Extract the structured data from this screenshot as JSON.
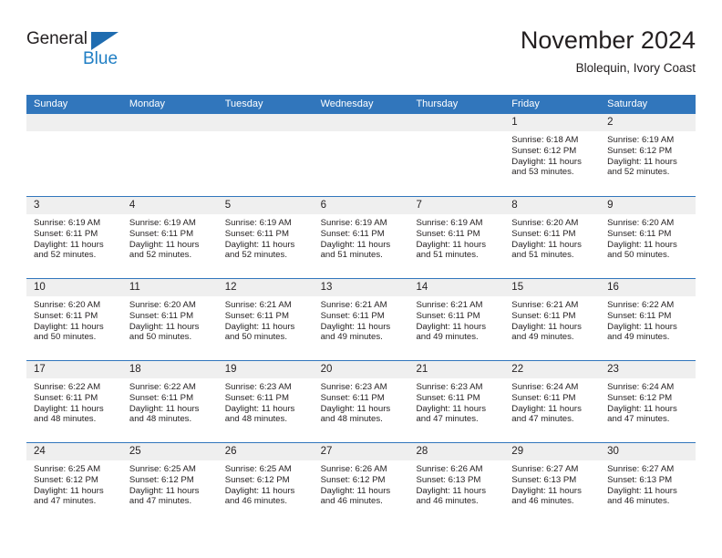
{
  "brand": {
    "name_top": "General",
    "name_bottom": "Blue",
    "triangle_color": "#1f6cb0",
    "blue_color": "#1f7ec4"
  },
  "header": {
    "title": "November 2024",
    "subtitle": "Blolequin, Ivory Coast"
  },
  "theme": {
    "header_blue": "#3176bc",
    "day_band_gray": "#efefef",
    "text": "#231f20"
  },
  "weekdays": [
    "Sunday",
    "Monday",
    "Tuesday",
    "Wednesday",
    "Thursday",
    "Friday",
    "Saturday"
  ],
  "weeks": [
    [
      {
        "day": "",
        "sunrise": "",
        "sunset": "",
        "daylight_line1": "",
        "daylight_line2": ""
      },
      {
        "day": "",
        "sunrise": "",
        "sunset": "",
        "daylight_line1": "",
        "daylight_line2": ""
      },
      {
        "day": "",
        "sunrise": "",
        "sunset": "",
        "daylight_line1": "",
        "daylight_line2": ""
      },
      {
        "day": "",
        "sunrise": "",
        "sunset": "",
        "daylight_line1": "",
        "daylight_line2": ""
      },
      {
        "day": "",
        "sunrise": "",
        "sunset": "",
        "daylight_line1": "",
        "daylight_line2": ""
      },
      {
        "day": "1",
        "sunrise": "Sunrise: 6:18 AM",
        "sunset": "Sunset: 6:12 PM",
        "daylight_line1": "Daylight: 11 hours",
        "daylight_line2": "and 53 minutes."
      },
      {
        "day": "2",
        "sunrise": "Sunrise: 6:19 AM",
        "sunset": "Sunset: 6:12 PM",
        "daylight_line1": "Daylight: 11 hours",
        "daylight_line2": "and 52 minutes."
      }
    ],
    [
      {
        "day": "3",
        "sunrise": "Sunrise: 6:19 AM",
        "sunset": "Sunset: 6:11 PM",
        "daylight_line1": "Daylight: 11 hours",
        "daylight_line2": "and 52 minutes."
      },
      {
        "day": "4",
        "sunrise": "Sunrise: 6:19 AM",
        "sunset": "Sunset: 6:11 PM",
        "daylight_line1": "Daylight: 11 hours",
        "daylight_line2": "and 52 minutes."
      },
      {
        "day": "5",
        "sunrise": "Sunrise: 6:19 AM",
        "sunset": "Sunset: 6:11 PM",
        "daylight_line1": "Daylight: 11 hours",
        "daylight_line2": "and 52 minutes."
      },
      {
        "day": "6",
        "sunrise": "Sunrise: 6:19 AM",
        "sunset": "Sunset: 6:11 PM",
        "daylight_line1": "Daylight: 11 hours",
        "daylight_line2": "and 51 minutes."
      },
      {
        "day": "7",
        "sunrise": "Sunrise: 6:19 AM",
        "sunset": "Sunset: 6:11 PM",
        "daylight_line1": "Daylight: 11 hours",
        "daylight_line2": "and 51 minutes."
      },
      {
        "day": "8",
        "sunrise": "Sunrise: 6:20 AM",
        "sunset": "Sunset: 6:11 PM",
        "daylight_line1": "Daylight: 11 hours",
        "daylight_line2": "and 51 minutes."
      },
      {
        "day": "9",
        "sunrise": "Sunrise: 6:20 AM",
        "sunset": "Sunset: 6:11 PM",
        "daylight_line1": "Daylight: 11 hours",
        "daylight_line2": "and 50 minutes."
      }
    ],
    [
      {
        "day": "10",
        "sunrise": "Sunrise: 6:20 AM",
        "sunset": "Sunset: 6:11 PM",
        "daylight_line1": "Daylight: 11 hours",
        "daylight_line2": "and 50 minutes."
      },
      {
        "day": "11",
        "sunrise": "Sunrise: 6:20 AM",
        "sunset": "Sunset: 6:11 PM",
        "daylight_line1": "Daylight: 11 hours",
        "daylight_line2": "and 50 minutes."
      },
      {
        "day": "12",
        "sunrise": "Sunrise: 6:21 AM",
        "sunset": "Sunset: 6:11 PM",
        "daylight_line1": "Daylight: 11 hours",
        "daylight_line2": "and 50 minutes."
      },
      {
        "day": "13",
        "sunrise": "Sunrise: 6:21 AM",
        "sunset": "Sunset: 6:11 PM",
        "daylight_line1": "Daylight: 11 hours",
        "daylight_line2": "and 49 minutes."
      },
      {
        "day": "14",
        "sunrise": "Sunrise: 6:21 AM",
        "sunset": "Sunset: 6:11 PM",
        "daylight_line1": "Daylight: 11 hours",
        "daylight_line2": "and 49 minutes."
      },
      {
        "day": "15",
        "sunrise": "Sunrise: 6:21 AM",
        "sunset": "Sunset: 6:11 PM",
        "daylight_line1": "Daylight: 11 hours",
        "daylight_line2": "and 49 minutes."
      },
      {
        "day": "16",
        "sunrise": "Sunrise: 6:22 AM",
        "sunset": "Sunset: 6:11 PM",
        "daylight_line1": "Daylight: 11 hours",
        "daylight_line2": "and 49 minutes."
      }
    ],
    [
      {
        "day": "17",
        "sunrise": "Sunrise: 6:22 AM",
        "sunset": "Sunset: 6:11 PM",
        "daylight_line1": "Daylight: 11 hours",
        "daylight_line2": "and 48 minutes."
      },
      {
        "day": "18",
        "sunrise": "Sunrise: 6:22 AM",
        "sunset": "Sunset: 6:11 PM",
        "daylight_line1": "Daylight: 11 hours",
        "daylight_line2": "and 48 minutes."
      },
      {
        "day": "19",
        "sunrise": "Sunrise: 6:23 AM",
        "sunset": "Sunset: 6:11 PM",
        "daylight_line1": "Daylight: 11 hours",
        "daylight_line2": "and 48 minutes."
      },
      {
        "day": "20",
        "sunrise": "Sunrise: 6:23 AM",
        "sunset": "Sunset: 6:11 PM",
        "daylight_line1": "Daylight: 11 hours",
        "daylight_line2": "and 48 minutes."
      },
      {
        "day": "21",
        "sunrise": "Sunrise: 6:23 AM",
        "sunset": "Sunset: 6:11 PM",
        "daylight_line1": "Daylight: 11 hours",
        "daylight_line2": "and 47 minutes."
      },
      {
        "day": "22",
        "sunrise": "Sunrise: 6:24 AM",
        "sunset": "Sunset: 6:11 PM",
        "daylight_line1": "Daylight: 11 hours",
        "daylight_line2": "and 47 minutes."
      },
      {
        "day": "23",
        "sunrise": "Sunrise: 6:24 AM",
        "sunset": "Sunset: 6:12 PM",
        "daylight_line1": "Daylight: 11 hours",
        "daylight_line2": "and 47 minutes."
      }
    ],
    [
      {
        "day": "24",
        "sunrise": "Sunrise: 6:25 AM",
        "sunset": "Sunset: 6:12 PM",
        "daylight_line1": "Daylight: 11 hours",
        "daylight_line2": "and 47 minutes."
      },
      {
        "day": "25",
        "sunrise": "Sunrise: 6:25 AM",
        "sunset": "Sunset: 6:12 PM",
        "daylight_line1": "Daylight: 11 hours",
        "daylight_line2": "and 47 minutes."
      },
      {
        "day": "26",
        "sunrise": "Sunrise: 6:25 AM",
        "sunset": "Sunset: 6:12 PM",
        "daylight_line1": "Daylight: 11 hours",
        "daylight_line2": "and 46 minutes."
      },
      {
        "day": "27",
        "sunrise": "Sunrise: 6:26 AM",
        "sunset": "Sunset: 6:12 PM",
        "daylight_line1": "Daylight: 11 hours",
        "daylight_line2": "and 46 minutes."
      },
      {
        "day": "28",
        "sunrise": "Sunrise: 6:26 AM",
        "sunset": "Sunset: 6:13 PM",
        "daylight_line1": "Daylight: 11 hours",
        "daylight_line2": "and 46 minutes."
      },
      {
        "day": "29",
        "sunrise": "Sunrise: 6:27 AM",
        "sunset": "Sunset: 6:13 PM",
        "daylight_line1": "Daylight: 11 hours",
        "daylight_line2": "and 46 minutes."
      },
      {
        "day": "30",
        "sunrise": "Sunrise: 6:27 AM",
        "sunset": "Sunset: 6:13 PM",
        "daylight_line1": "Daylight: 11 hours",
        "daylight_line2": "and 46 minutes."
      }
    ]
  ]
}
